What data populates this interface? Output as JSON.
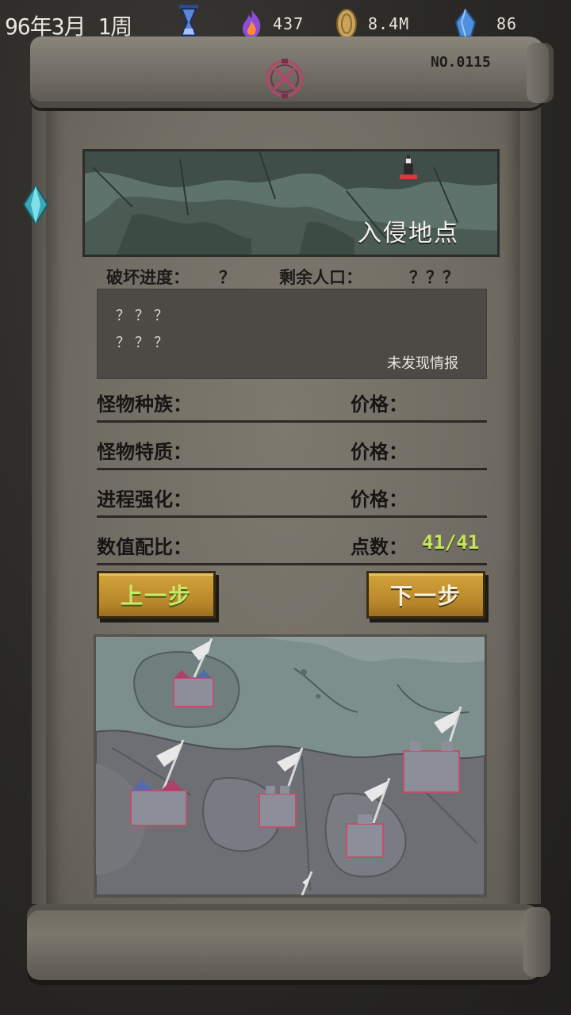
{
  "topbar": {
    "date": "96年3月 1周",
    "flame_value": "437",
    "coin_value": "8.4M",
    "crystal_value": "86"
  },
  "scroll": {
    "serial": "NO.0115"
  },
  "preview": {
    "title": "入侵地点"
  },
  "info": {
    "destruction_label": "破坏进度：",
    "destruction_value": "？",
    "population_label": "剩余人口：",
    "population_value": "？？？"
  },
  "intel": {
    "line1": "？？？",
    "line2": "？？？",
    "status": "未发现情报"
  },
  "fields": [
    {
      "label": "怪物种族：",
      "right": "价格："
    },
    {
      "label": "怪物特质：",
      "right": "价格："
    },
    {
      "label": "进程强化：",
      "right": "价格："
    },
    {
      "label": "数值配比：",
      "right": "点数：",
      "points": "41/41"
    }
  ],
  "buttons": {
    "prev": "上一步",
    "next": "下一步"
  },
  "colors": {
    "button_gold": "#c4942f",
    "points_green": "#c7e45a",
    "paper": "#7e796f"
  }
}
